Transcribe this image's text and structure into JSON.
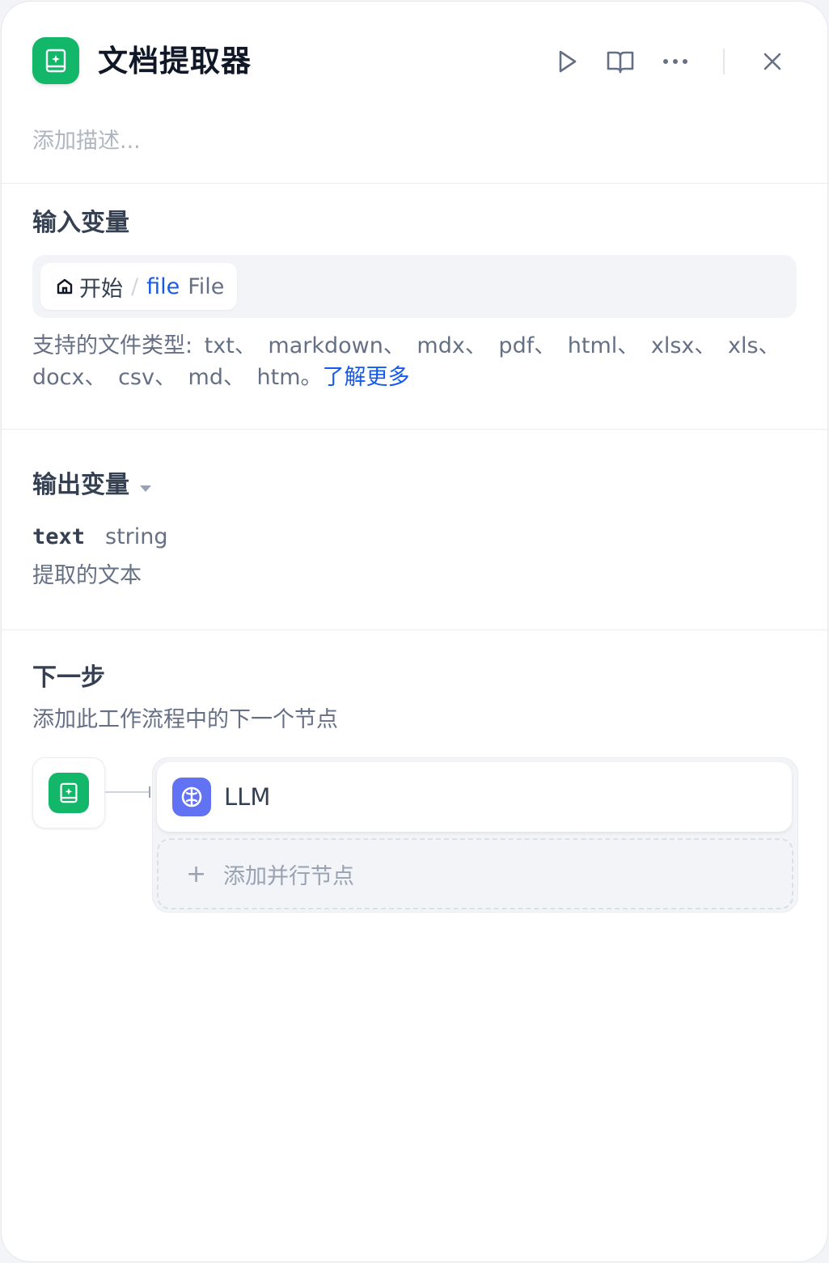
{
  "header": {
    "title": "文档提取器",
    "description_placeholder": "添加描述..."
  },
  "input": {
    "section_title": "输入变量",
    "variable": {
      "node": "开始",
      "name": "file",
      "type": "File"
    },
    "supported_prefix": "支持的文件类型: txt、 markdown、 mdx、 pdf、 html、 xlsx、 xls、 docx、 csv、 md、 htm。",
    "learn_more": "了解更多"
  },
  "output": {
    "section_title": "输出变量",
    "var_name": "text",
    "var_type": "string",
    "var_desc": "提取的文本"
  },
  "next_step": {
    "section_title": "下一步",
    "subtitle": "添加此工作流程中的下一个节点",
    "next_node_label": "LLM",
    "add_parallel_label": "添加并行节点",
    "add_symbol": "+"
  },
  "colors": {
    "accent_green": "#12b76a",
    "llm_blue": "#6172f3",
    "link_blue": "#155aef"
  }
}
